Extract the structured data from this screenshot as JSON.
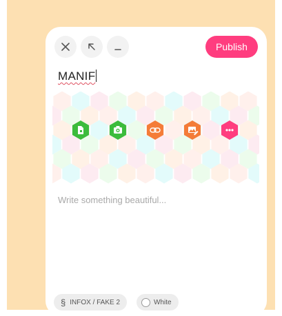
{
  "toolbar": {
    "close_icon": "close-icon",
    "expand_icon": "arrow-up-left-icon",
    "minimize_icon": "minimize-icon",
    "publish_label": "Publish"
  },
  "editor": {
    "title_value": "MANIF",
    "body_placeholder": "Write something beautiful..."
  },
  "media_buttons": [
    {
      "name": "file-icon",
      "color": "#3cbc3c"
    },
    {
      "name": "camera-icon",
      "color": "#3cbc3c"
    },
    {
      "name": "link-icon",
      "color": "#f47c38"
    },
    {
      "name": "image-edit-icon",
      "color": "#f47c38"
    },
    {
      "name": "more-icon",
      "color": "#ff3d7f"
    }
  ],
  "footer": {
    "category_label": "INFOX / FAKE 2",
    "category_icon": "section-icon",
    "theme_label": "White"
  },
  "colors": {
    "page_background": "#fde0b2",
    "accent": "#ff3d7f",
    "hex_palette": [
      "#fff0ec",
      "#e3fbfb",
      "#fdebf1",
      "#ecfcec",
      "#fff1e6"
    ]
  }
}
